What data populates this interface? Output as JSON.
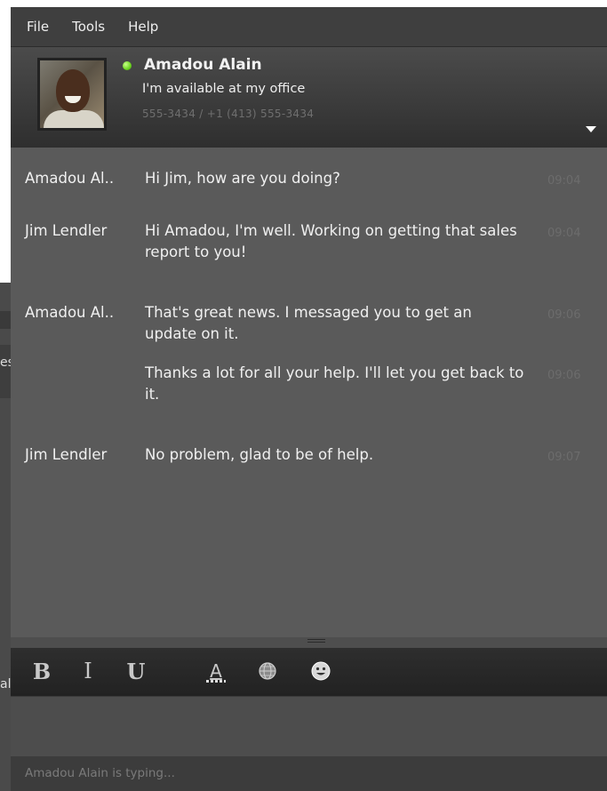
{
  "background_window": {
    "fragment_1": "es",
    "fragment_2": "al"
  },
  "menu": [
    "File",
    "Tools",
    "Help"
  ],
  "contact": {
    "name": "Amadou Alain",
    "status_message": "I'm available at my office",
    "phone": "555-3434 / +1 (413) 555-3434",
    "presence_color": "#6bd51f"
  },
  "messages": [
    {
      "sender": "Amadou Al..",
      "text": "Hi Jim, how are you doing?",
      "time": "09:04"
    },
    {
      "sender": "Jim Lendler",
      "text": "Hi Amadou, I'm well.  Working on getting that sales report to you!",
      "time": "09:04"
    },
    {
      "sender": "Amadou Al..",
      "text": "That's great news. I messaged you to get an update on it.",
      "time": "09:06"
    },
    {
      "sender": "",
      "text": "Thanks a lot for all your help. I'll let you get back to it.",
      "time": "09:06"
    },
    {
      "sender": "Jim Lendler",
      "text": "No problem, glad to be of help.",
      "time": "09:07"
    }
  ],
  "toolbar": {
    "bold": "B",
    "italic": "I",
    "underline": "U",
    "font_color": "A"
  },
  "status_bar": {
    "typing": "Amadou Alain is typing..."
  }
}
